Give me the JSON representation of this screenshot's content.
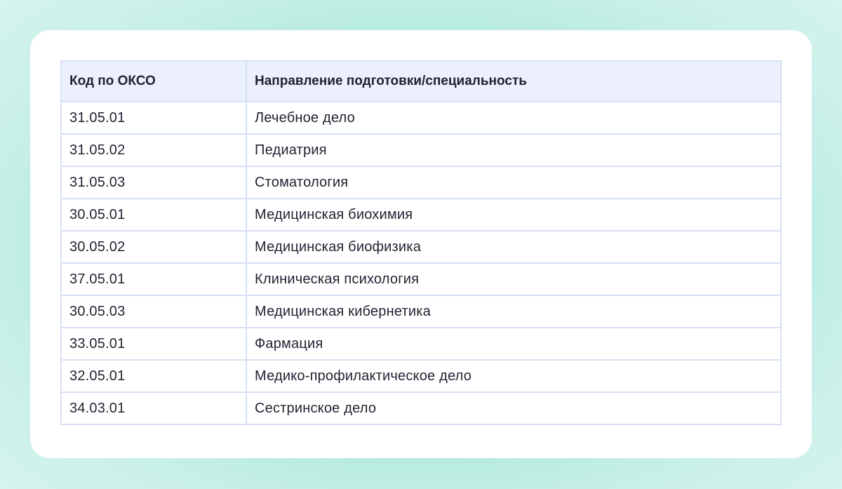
{
  "table": {
    "headers": {
      "code": "Код по ОКСО",
      "name": "Направление подготовки/специальность"
    },
    "rows": [
      {
        "code": "31.05.01",
        "name": "Лечебное дело"
      },
      {
        "code": "31.05.02",
        "name": "Педиатрия"
      },
      {
        "code": "31.05.03",
        "name": "Стоматология"
      },
      {
        "code": "30.05.01",
        "name": "Медицинская биохимия"
      },
      {
        "code": "30.05.02",
        "name": "Медицинская биофизика"
      },
      {
        "code": "37.05.01",
        "name": "Клиническая психология"
      },
      {
        "code": "30.05.03",
        "name": "Медицинская кибернетика"
      },
      {
        "code": "33.05.01",
        "name": "Фармация"
      },
      {
        "code": "32.05.01",
        "name": "Медико-профилактическое дело"
      },
      {
        "code": "34.03.01",
        "name": "Сестринское дело"
      }
    ]
  },
  "colors": {
    "header_bg": "#ebf0fc",
    "border": "#d7e0f5",
    "card_bg": "#ffffff",
    "background_accent": "#8fdfd0"
  }
}
